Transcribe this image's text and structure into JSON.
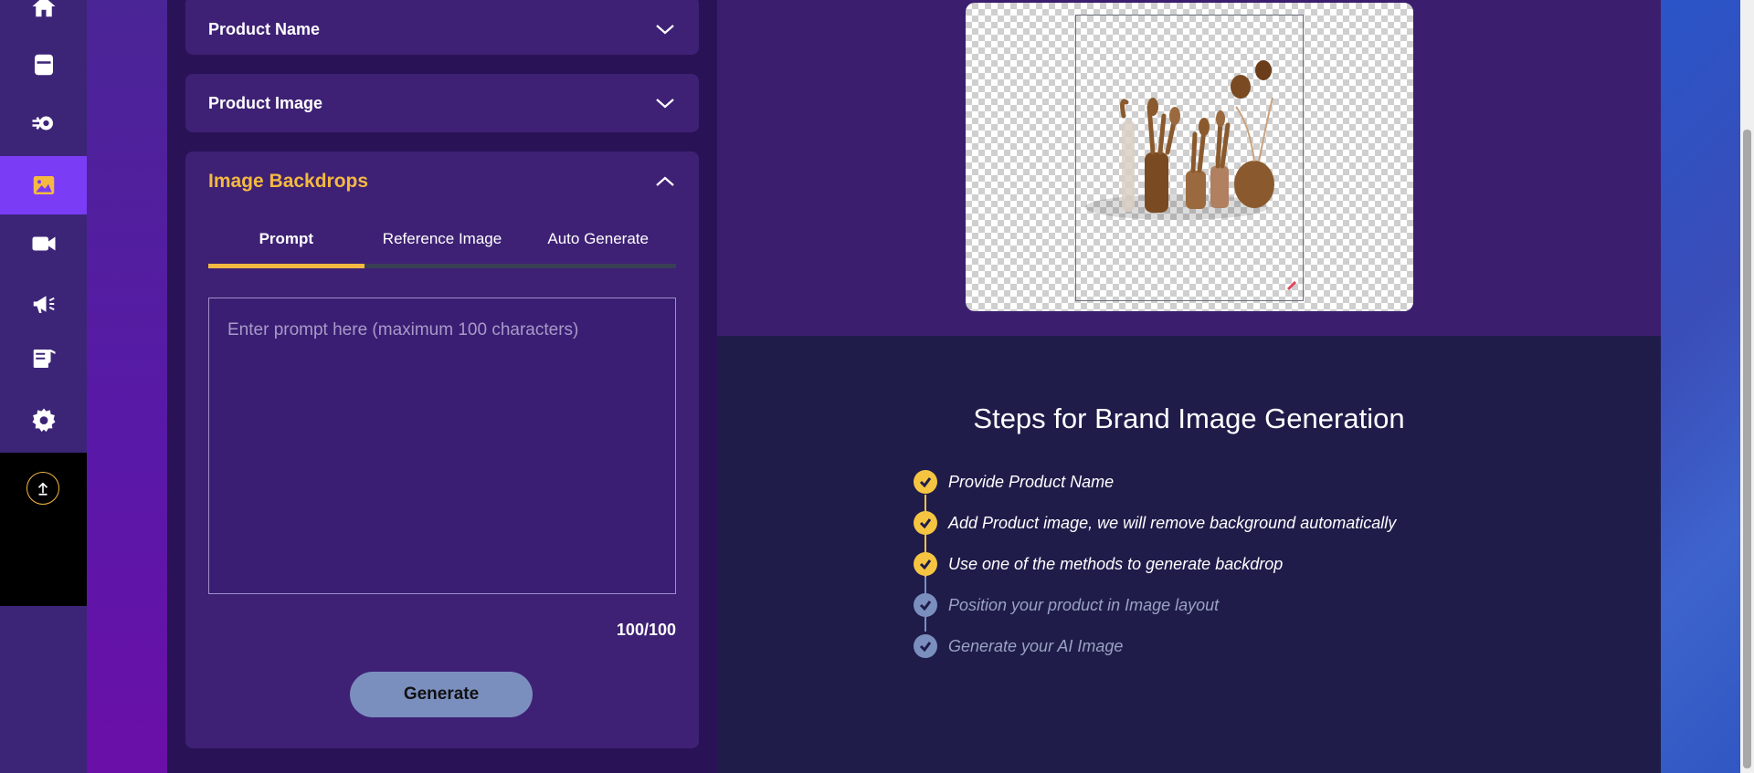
{
  "sidebar": {
    "items": [
      {
        "icon": "home-icon",
        "active": false
      },
      {
        "icon": "calendar-icon",
        "active": false
      },
      {
        "icon": "refresh-gear-icon",
        "active": false
      },
      {
        "icon": "image-icon",
        "active": true
      },
      {
        "icon": "video-camera-icon",
        "active": false
      },
      {
        "icon": "megaphone-icon",
        "active": false
      },
      {
        "icon": "music-note-list-icon",
        "active": false
      },
      {
        "icon": "gear-icon",
        "active": false
      }
    ],
    "upload_icon": "upload-icon"
  },
  "panel": {
    "product_name": {
      "title": "Product Name",
      "expanded": false
    },
    "product_image": {
      "title": "Product Image",
      "expanded": false
    },
    "image_backdrops": {
      "title": "Image Backdrops",
      "expanded": true,
      "tabs": [
        "Prompt",
        "Reference Image",
        "Auto Generate"
      ],
      "active_tab": "Prompt",
      "prompt_placeholder": "Enter prompt here (maximum 100 characters)",
      "counter": "100/100",
      "generate_label": "Generate"
    }
  },
  "steps": {
    "title": "Steps for Brand Image Generation",
    "items": [
      {
        "text": "Provide Product Name",
        "done": true
      },
      {
        "text": "Add Product image, we will remove background automatically",
        "done": true
      },
      {
        "text": "Use one of the methods to generate backdrop",
        "done": true
      },
      {
        "text": "Position your product in Image layout",
        "done": false
      },
      {
        "text": "Generate your AI Image",
        "done": false
      }
    ]
  },
  "colors": {
    "accent": "#f5b942",
    "active_rail": "#7a3cf5",
    "step_done": "#f5c542",
    "step_pending": "#7b8fbf"
  }
}
